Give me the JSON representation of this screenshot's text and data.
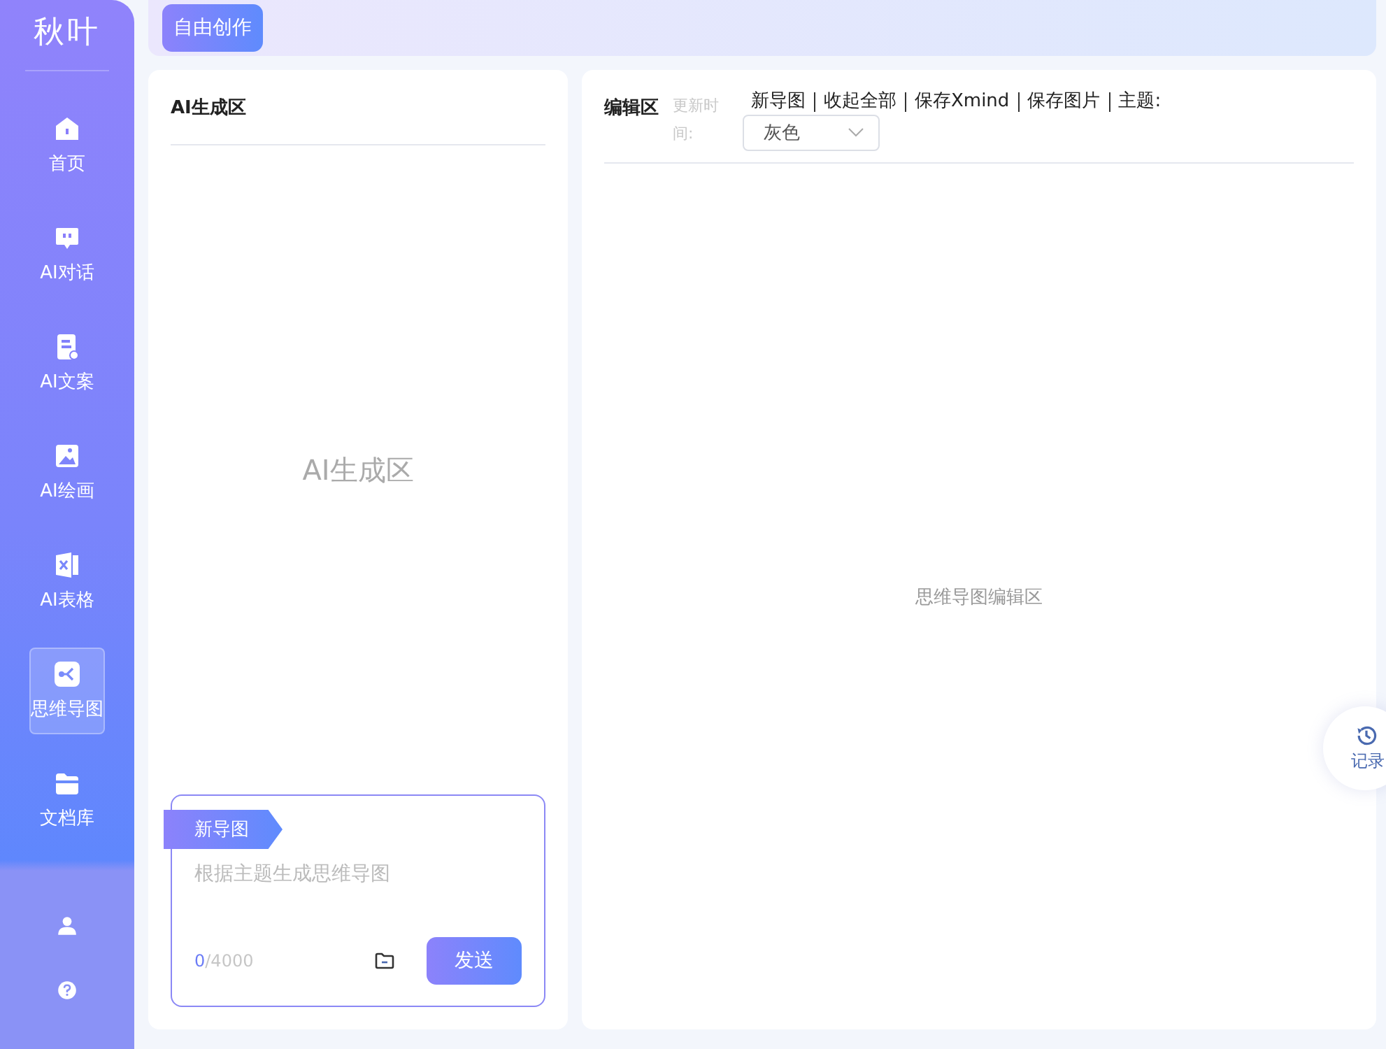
{
  "sidebar": {
    "logo": "秋叶",
    "items": [
      {
        "label": "首页",
        "selected": false
      },
      {
        "label": "AI对话",
        "selected": false
      },
      {
        "label": "AI文案",
        "selected": false
      },
      {
        "label": "AI绘画",
        "selected": false
      },
      {
        "label": "AI表格",
        "selected": false
      },
      {
        "label": "思维导图",
        "selected": true
      },
      {
        "label": "文档库",
        "selected": false
      }
    ]
  },
  "top_bar": {
    "button": "自由创作"
  },
  "ai_panel": {
    "title": "AI生成区",
    "placeholder_text": "AI生成区",
    "composer": {
      "tag": "新导图",
      "placeholder": "根据主题生成思维导图",
      "count_current": "0",
      "count_limit": "/4000",
      "send": "发送"
    }
  },
  "editor": {
    "title": "编辑区",
    "updated_label": "更新时间:",
    "actions": [
      "新导图",
      "收起全部",
      "保存Xmind",
      "保存图片"
    ],
    "theme_label": "主题:",
    "theme_value": "灰色",
    "empty_text": "思维导图编辑区"
  },
  "record_button": {
    "label": "记录"
  }
}
